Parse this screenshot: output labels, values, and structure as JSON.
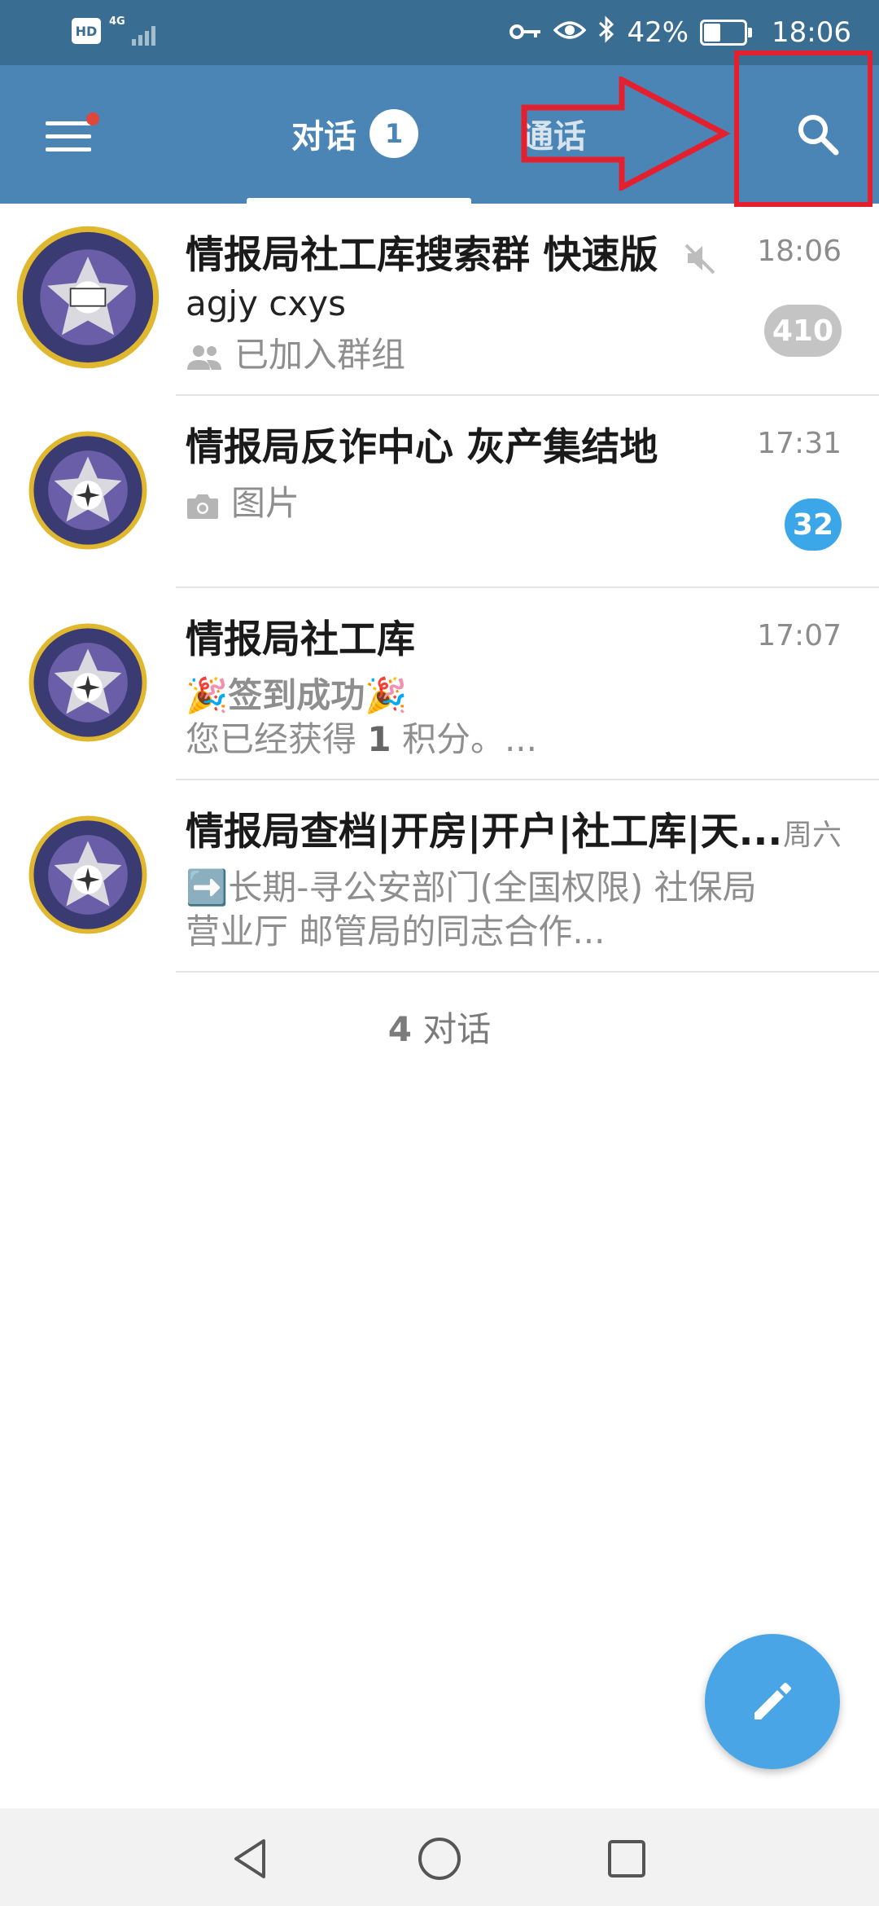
{
  "status_bar": {
    "hd": "HD",
    "network": "4G",
    "battery_text": "42%",
    "battery_level": 0.42,
    "time": "18:06",
    "icons": [
      "key-icon",
      "eye-icon",
      "bluetooth-icon",
      "battery-icon"
    ]
  },
  "header": {
    "menu_has_notification": true,
    "tabs": [
      {
        "label": "对话",
        "badge": "1",
        "selected": true
      },
      {
        "label": "通话",
        "selected": false
      }
    ],
    "icons": [
      "menu-icon",
      "search-icon"
    ]
  },
  "chats": [
    {
      "title": "情报局社工库搜索群 快速版",
      "time": "18:06",
      "muted": true,
      "line2": "agjy cxys",
      "line3": "已加入群组",
      "line3_icon": "group-icon",
      "badge": "410",
      "badge_color": "#c4c4c4"
    },
    {
      "title": "情报局反诈中心 灰产集结地",
      "time": "17:31",
      "line2_icon": "camera-icon",
      "line2": "图片",
      "badge": "32",
      "badge_color": "#3ba7e8"
    },
    {
      "title": "情报局社工库",
      "time": "17:07",
      "line2": "🎉签到成功🎉",
      "line3_prefix": "您已经获得 ",
      "line3_points": "1",
      "line3_suffix": " 积分。..."
    },
    {
      "title": "情报局查档|开房|开户|社工库|天...",
      "time": "周六",
      "line2": "➡️长期-寻公安部门(全国权限) 社保局",
      "line3": "营业厅 邮管局的同志合作..."
    }
  ],
  "footer": {
    "count": "4",
    "label": " 对话"
  },
  "fab": {
    "icon": "pencil-icon",
    "color": "#4aa5e6"
  },
  "nav": {
    "icons": [
      "back-icon",
      "home-icon",
      "recents-icon"
    ]
  },
  "colors": {
    "status_bar": "#3a6d92",
    "app_bar": "#4a85b5",
    "annotation": "#e5202e"
  }
}
